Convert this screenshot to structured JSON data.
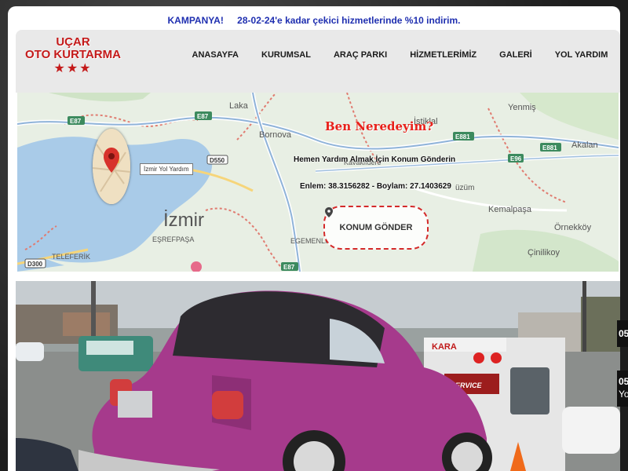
{
  "campaign": {
    "label": "KAMPANYA!",
    "text": "28-02-24'e kadar çekici hizmetlerinde %10 indirim."
  },
  "logo": {
    "line1": "UÇAR",
    "line2": "OTO KURTARMA"
  },
  "nav": {
    "items": [
      "ANASAYFA",
      "KURUMSAL",
      "ARAÇ PARKI",
      "HİZMETLERİMİZ",
      "GALERİ",
      "YOL YARDIM"
    ]
  },
  "map": {
    "title": "Ben Neredeyim?",
    "subtitle": "Hemen Yardım Almak İçin Konum Gönderin",
    "coords": "Enlem: 38.3156282 - Boylam: 27.1403629",
    "pin_tooltip": "İzmir Yol Yardım",
    "send_button": "KONUM GÖNDER",
    "labels": {
      "laka": "Laka",
      "bornova": "Bornova",
      "istiklal": "İstiklal",
      "yenmis": "Yenmiş",
      "akalan": "Akalan",
      "kavaklidere": "Kavaklıdere",
      "izmir": "İzmir",
      "esrefpasa": "EŞREFPAŞA",
      "egemenlik": "EGEMENLİ",
      "teleferik": "TELEFERİK",
      "kemalpasa": "Kemalpaşa",
      "ornekkoy": "Örnekköy",
      "cinilikoy": "Çinilikoy",
      "uzum": "üzüm",
      "road_e87a": "E87",
      "road_e87b": "E87",
      "road_e87c": "E87",
      "road_e881a": "E881",
      "road_e881b": "E881",
      "road_e96": "E96",
      "road_d550": "D550",
      "road_d300": "D300"
    }
  },
  "side_tags": [
    "05",
    "05"
  ],
  "side_tag_yo": "Yo",
  "hero": {
    "truck_text": "KARA",
    "truck_service": "SERVICE"
  },
  "colors": {
    "brand_red": "#c41a1a",
    "campaign_blue": "#1f2fb0",
    "header_bg": "#e9e9e9"
  }
}
